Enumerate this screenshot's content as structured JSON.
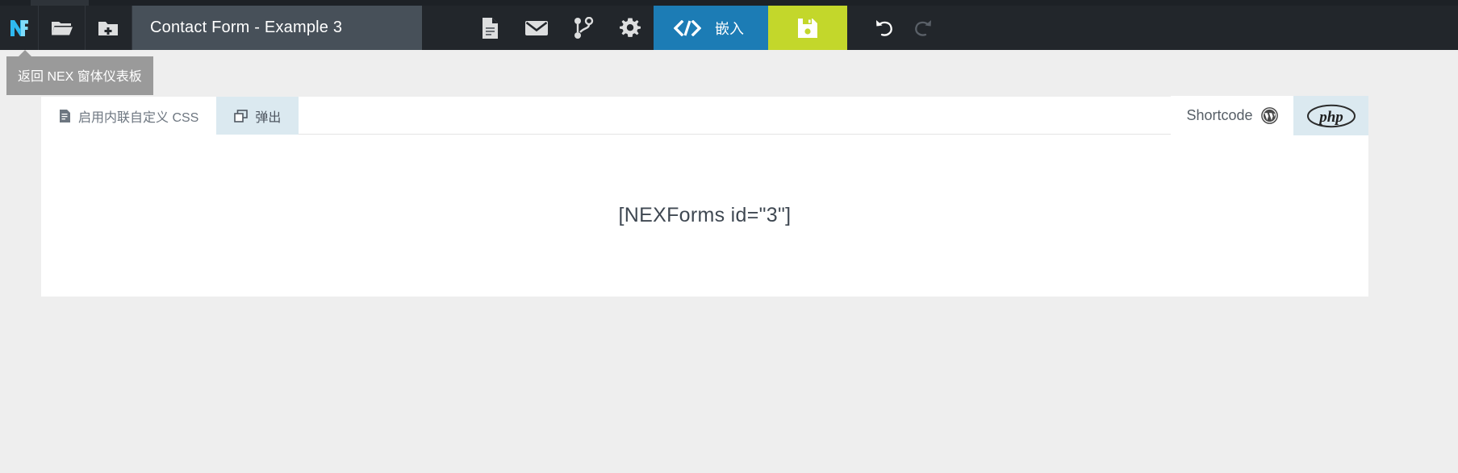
{
  "window": {
    "app_logo": "nexforms-logo-icon",
    "title_value": "Contact Form - Example 3"
  },
  "toolbar": {
    "items": [
      {
        "name": "open-folder",
        "icon": "folder-open-icon",
        "label": ""
      },
      {
        "name": "new-folder",
        "icon": "folder-add-icon",
        "label": ""
      },
      {
        "name": "form-fields",
        "icon": "document-icon",
        "label": ""
      },
      {
        "name": "email-settings",
        "icon": "envelope-icon",
        "label": ""
      },
      {
        "name": "logic",
        "icon": "git-branch-icon",
        "label": ""
      },
      {
        "name": "settings",
        "icon": "gear-icon",
        "label": ""
      }
    ],
    "embed_label": "嵌入",
    "embed_icon": "code-brackets-icon",
    "save_icon": "floppy-disk-icon",
    "undo_icon": "undo-arrow-icon",
    "redo_icon": "redo-arrow-icon",
    "embed_color": "#1c7cb5",
    "save_color": "#c3d72b",
    "toolbar_color": "#22262b",
    "title_field_color": "#475059"
  },
  "tooltip": {
    "text": "返回 NEX 窗体仪表板"
  },
  "panel": {
    "tabs_left": [
      {
        "name": "tab-inline-css",
        "icon": "document-css-icon",
        "label": "启用内联自定义 CSS",
        "active": false
      },
      {
        "name": "tab-popup",
        "icon": "popout-window-icon",
        "label": "弹出",
        "active": true
      }
    ],
    "tabs_right": [
      {
        "name": "tab-shortcode",
        "label": "Shortcode",
        "icon": "wordpress-icon",
        "active": true
      },
      {
        "name": "tab-php",
        "label": "php",
        "icon": "php-oval-icon",
        "active": false
      }
    ],
    "content": {
      "shortcode": "[NEXForms id=\"3\"]"
    }
  }
}
